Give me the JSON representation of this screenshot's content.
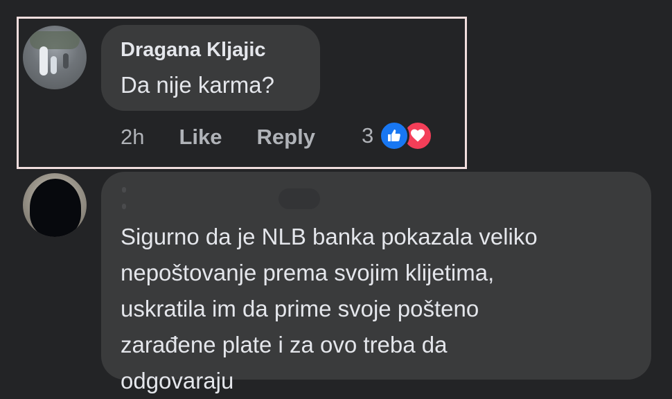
{
  "comments": [
    {
      "author": "Dragana Kljajic",
      "text": "Da nije karma?",
      "time": "2h",
      "like_label": "Like",
      "reply_label": "Reply",
      "reaction_count": "3",
      "reactions": [
        "like-icon",
        "love-icon"
      ],
      "highlighted": true
    },
    {
      "author_redacted": true,
      "text_lines": [
        "Sigurno da je NLB banka pokazala veliko",
        "nepoštovanje prema svojim klijetima,",
        "uskratila im da prime svoje pošteno",
        "zarađene plate i za ovo treba da",
        "odgovaraju"
      ]
    }
  ],
  "colors": {
    "background": "#232426",
    "bubble": "#3a3b3c",
    "primary_text": "#e4e6eb",
    "secondary_text": "#b0b3b8",
    "like_blue": "#1877f2",
    "love_red": "#f33e58",
    "highlight_border": "#f1dede"
  }
}
